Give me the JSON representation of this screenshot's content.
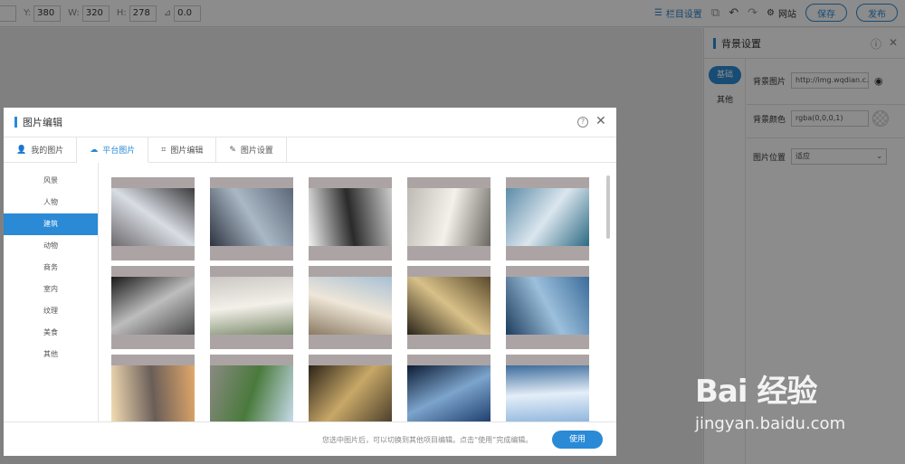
{
  "toolbar": {
    "y_label": "Y:",
    "y_value": "380",
    "w_label": "W:",
    "w_value": "320",
    "h_label": "H:",
    "h_value": "278",
    "angle_value": "0.0",
    "column_settings": "栏目设置",
    "website": "网站",
    "save": "保存",
    "publish": "发布"
  },
  "right_panel": {
    "title": "背景设置",
    "tabs": [
      "基础",
      "其他"
    ],
    "bg_image_label": "背景图片",
    "bg_image_value": "http://img.wqdian.c...",
    "bg_color_label": "背景颜色",
    "bg_color_value": "rgba(0,0,0,1)",
    "bg_position_label": "图片位置",
    "bg_position_value": "适应"
  },
  "modal": {
    "title": "图片编辑",
    "tabs": [
      "我的图片",
      "平台图片",
      "图片编辑",
      "图片设置"
    ],
    "categories": [
      "风景",
      "人物",
      "建筑",
      "动物",
      "商务",
      "室内",
      "纹理",
      "美食",
      "其他"
    ],
    "active_category": "建筑",
    "hint": "您选中图片后，可以切换到其他项目编辑。点击“使用”完成编辑。",
    "use": "使用"
  },
  "thumbnails": [
    {
      "name": "skylight-courtyard",
      "colors": [
        "#6e6a6c",
        "#d8dde4",
        "#3c3a3c"
      ]
    },
    {
      "name": "glass-facade",
      "colors": [
        "#2e3440",
        "#aab8c6",
        "#5c6878"
      ]
    },
    {
      "name": "white-structure",
      "colors": [
        "#f2f2f2",
        "#2a2a2a",
        "#cccccc"
      ]
    },
    {
      "name": "church-interior",
      "colors": [
        "#bdbab4",
        "#f4f0ea",
        "#6a6660"
      ]
    },
    {
      "name": "futuristic-building",
      "colors": [
        "#5c8ca8",
        "#dbe6ee",
        "#2c6a82"
      ]
    },
    {
      "name": "abstract-curves",
      "colors": [
        "#1a1a1a",
        "#bdbdbd",
        "#4a4a4a"
      ]
    },
    {
      "name": "taj-mahal-pool",
      "colors": [
        "#cbc8c4",
        "#f3efe9",
        "#7a8a6a"
      ]
    },
    {
      "name": "taj-mahal-dome",
      "colors": [
        "#a8c0d4",
        "#efe6d8",
        "#8a7a62"
      ]
    },
    {
      "name": "chandelier",
      "colors": [
        "#5a4a2c",
        "#d8c088",
        "#2a2418"
      ]
    },
    {
      "name": "skyscrapers",
      "colors": [
        "#3c6c9a",
        "#9cc0dc",
        "#1c3c5c"
      ]
    },
    {
      "name": "city-sunset",
      "colors": [
        "#e2a86a",
        "#6a5e58",
        "#f4dcb4"
      ]
    },
    {
      "name": "great-wall",
      "colors": [
        "#c8dcec",
        "#4a7a3c",
        "#8a8a82"
      ]
    },
    {
      "name": "grand-hall",
      "colors": [
        "#4a3e2a",
        "#c8a868",
        "#2c2418"
      ]
    },
    {
      "name": "observatory-night",
      "colors": [
        "#1c3c6c",
        "#7ca4cc",
        "#0c1c34"
      ]
    },
    {
      "name": "glass-tower",
      "colors": [
        "#8cb4dc",
        "#e4eef8",
        "#3c6c9c"
      ]
    }
  ],
  "watermark": {
    "logo": "Bai 经验",
    "url": "jingyan.baidu.com"
  }
}
